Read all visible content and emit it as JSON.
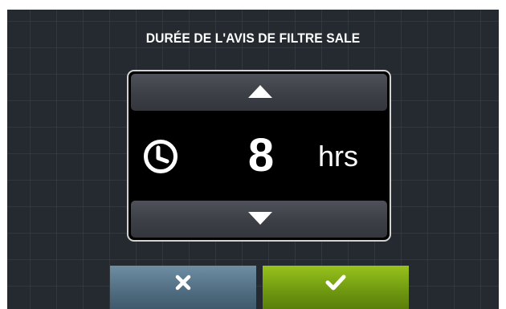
{
  "dialog": {
    "title": "DURÉE DE L'AVIS DE FILTRE SALE",
    "value": "8",
    "unit": "hrs"
  },
  "controls": {
    "increment_icon": "triangle-up-icon",
    "decrement_icon": "triangle-down-icon",
    "cancel_icon": "cross-icon",
    "confirm_icon": "checkmark-icon",
    "value_icon": "clock-icon"
  },
  "colors": {
    "background": "#252a30",
    "cancel": "#5a7a90",
    "confirm": "#7fab14",
    "text": "#ffffff"
  }
}
